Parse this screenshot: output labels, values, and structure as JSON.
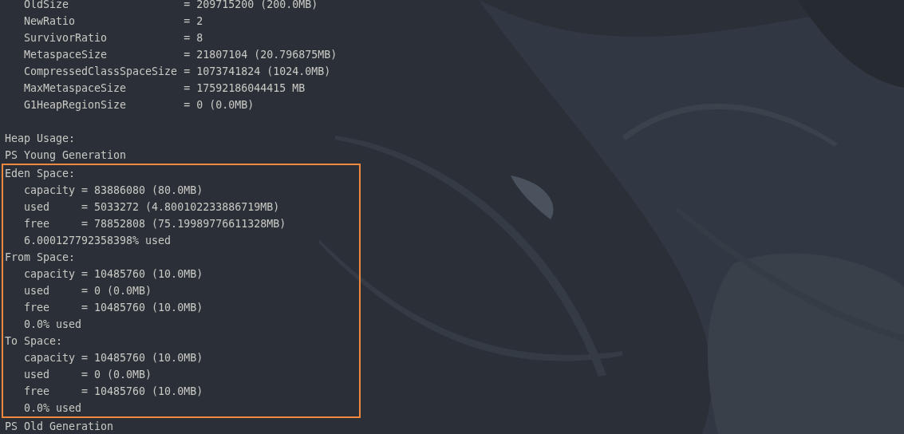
{
  "heap_config": [
    "OldSize                  = 209715200 (200.0MB)",
    "NewRatio                 = 2",
    "SurvivorRatio            = 8",
    "MetaspaceSize            = 21807104 (20.796875MB)",
    "CompressedClassSpaceSize = 1073741824 (1024.0MB)",
    "MaxMetaspaceSize         = 17592186044415 MB",
    "G1HeapRegionSize         = 0 (0.0MB)"
  ],
  "heap_usage": {
    "title": "Heap Usage:",
    "generation": "PS Young Generation",
    "highlighted_spaces": [
      {
        "name": "Eden Space:",
        "rows": [
          "capacity = 83886080 (80.0MB)",
          "used     = 5033272 (4.800102233886719MB)",
          "free     = 78852808 (75.19989776611328MB)",
          "6.000127792358398% used"
        ]
      },
      {
        "name": "From Space:",
        "rows": [
          "capacity = 10485760 (10.0MB)",
          "used     = 0 (0.0MB)",
          "free     = 10485760 (10.0MB)",
          "0.0% used"
        ]
      },
      {
        "name": "To Space:",
        "rows": [
          "capacity = 10485760 (10.0MB)",
          "used     = 0 (0.0MB)",
          "free     = 10485760 (10.0MB)",
          "0.0% used"
        ]
      }
    ],
    "next_generation": "PS Old Generation"
  }
}
